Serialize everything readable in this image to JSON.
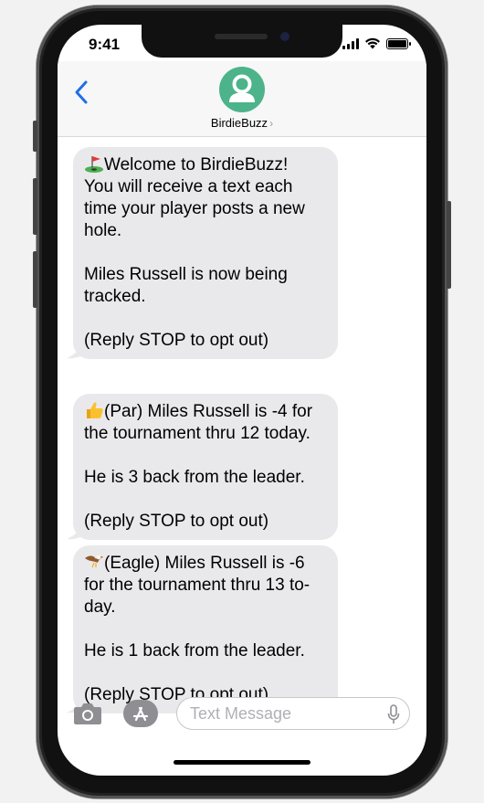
{
  "status_bar": {
    "time": "9:41"
  },
  "header": {
    "contact_name": "BirdieBuzz",
    "chevron": "›",
    "avatar_icon": "person-silhouette-icon",
    "avatar_color": "#4cb38b",
    "back_icon": "chevron-left-icon",
    "accent_color": "#1f6fe6"
  },
  "messages": [
    {
      "emoji": "golf-flag-icon",
      "lines": [
        "Welcome to BirdieBuzz!",
        "You will receive a text each",
        "time your player posts a new",
        "hole.",
        "",
        "Miles Russell is now being",
        "tracked.",
        "",
        "(Reply STOP to opt out)"
      ]
    },
    {
      "emoji": "thumbs-up-icon",
      "lines": [
        "(Par) Miles Russell is -4 for",
        "the tournament thru 12 today.",
        "",
        "He is 3 back from the leader.",
        "",
        "(Reply STOP to opt out)"
      ]
    },
    {
      "emoji": "eagle-icon",
      "lines": [
        "(Eagle) Miles Russell is -6",
        "for the tournament thru 13 to-",
        "day.",
        "",
        "He is 1 back from the leader.",
        "",
        "(Reply STOP to opt out)"
      ]
    }
  ],
  "composer": {
    "placeholder": "Text Message",
    "camera_icon": "camera-icon",
    "apps_icon": "app-store-icon",
    "mic_icon": "microphone-icon"
  }
}
